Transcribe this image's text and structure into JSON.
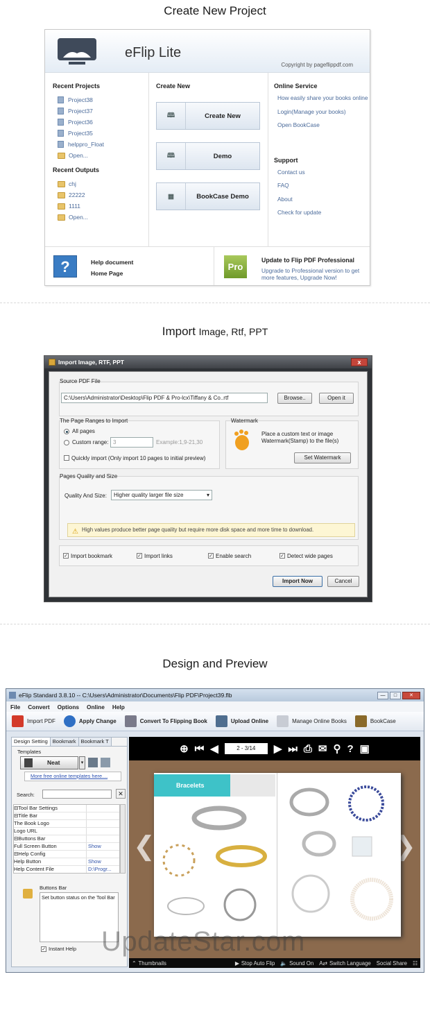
{
  "section1": {
    "heading": "Create New Project",
    "app_name": "eFlip  Lite",
    "copyright": "Copyright by pageflippdf.com",
    "recent_projects_title": "Recent Projects",
    "recent_projects": [
      "Project38",
      "Project37",
      "Project36",
      "Project35",
      "helppro_Float",
      "Open..."
    ],
    "recent_outputs_title": "Recent Outputs",
    "recent_outputs": [
      "chj",
      "22222",
      "1111",
      "Open..."
    ],
    "create_new_title": "Create New",
    "create_buttons": [
      "Create New",
      "Demo",
      "BookCase Demo"
    ],
    "online_service_title": "Online Service",
    "online_links": [
      "How easily share your books online",
      "Login(Manage your books)",
      "Open BookCase"
    ],
    "support_title": "Support",
    "support_links": [
      "Contact us",
      "FAQ",
      "About",
      "Check for update"
    ],
    "help_icon": "?",
    "help_document": "Help document",
    "home_page": "Home Page",
    "pro_badge": "Pro",
    "upgrade_title": "Update to Flip PDF Professional",
    "upgrade_text": "Upgrade to Professional version to get more features, Upgrade Now!"
  },
  "section2": {
    "heading_main": "Import",
    "heading_sub": "Image, Rtf, PPT",
    "dialog_title": "Import Image, RTF, PPT",
    "close_glyph": "x",
    "source_label": "Source PDF File",
    "source_path": "C:\\Users\\Administrator\\Desktop\\Flip PDF & Pro-lcx\\Tiffany & Co..rtf",
    "browse_btn": "Browse..",
    "open_btn": "Open it",
    "page_ranges_label": "The Page Ranges to Import",
    "all_pages": "All pages",
    "custom_range": "Custom range:",
    "custom_value": "3",
    "example_text": "Example:1,9-21,30",
    "quick_import": "Quickly import (Only import 10 pages to  initial  preview)",
    "watermark_label": "Watermark",
    "watermark_text": "Place a custom text or image Watermark(Stamp) to the file(s)",
    "set_watermark_btn": "Set Watermark",
    "quality_group_label": "Pages Quality and Size",
    "quality_label": "Quality And Size:",
    "quality_value": "Higher quality larger file size",
    "warning_text": "High values produce better page quality but require more disk space and more time to download.",
    "checkboxes": [
      "Import bookmark",
      "Import links",
      "Enable search",
      "Detect wide pages"
    ],
    "import_btn": "Import Now",
    "cancel_btn": "Cancel"
  },
  "section3": {
    "heading": "Design and Preview",
    "window_title": "eFlip Standard 3.8.10  -- C:\\Users\\Administrator\\Documents\\Flip PDF\\Project39.flb",
    "menu": [
      "File",
      "Convert",
      "Options",
      "Online",
      "Help"
    ],
    "toolbar": [
      "Import PDF",
      "Apply Change",
      "Convert To Flipping Book",
      "Upload Online",
      "Manage Online Books",
      "BookCase"
    ],
    "tabs": [
      "Design Setting",
      "Bookmark",
      "Bookmark T"
    ],
    "templates_label": "Templates",
    "template_name": "Neat",
    "more_templates": "More free online templates here....",
    "search_label": "Search:",
    "tree": [
      {
        "name": "⊟Tool Bar Settings",
        "value": ""
      },
      {
        "name": "  ⊟Title Bar",
        "value": ""
      },
      {
        "name": "        The Book Logo",
        "value": ""
      },
      {
        "name": "        Logo URL",
        "value": ""
      },
      {
        "name": "  ⊟Buttons Bar",
        "value": ""
      },
      {
        "name": "      Full Screen Button",
        "value": "Show"
      },
      {
        "name": "    ⊟Help Config",
        "value": ""
      },
      {
        "name": "        Help Button",
        "value": "Show"
      },
      {
        "name": "        Help Content File",
        "value": "D:\\Progr..."
      }
    ],
    "desc_title": "Buttons Bar",
    "desc_text": "Set button status on the Tool Bar",
    "instant_help": "Instant Help",
    "page_indicator": "2 - 3/14",
    "book_heading": "Bracelets",
    "bottom_left": "Thumbnails",
    "bottom_items": [
      "Stop Auto Flip",
      "Sound On",
      "Switch Language",
      "Social Share"
    ]
  },
  "watermark_text": "UpdateStar.com"
}
